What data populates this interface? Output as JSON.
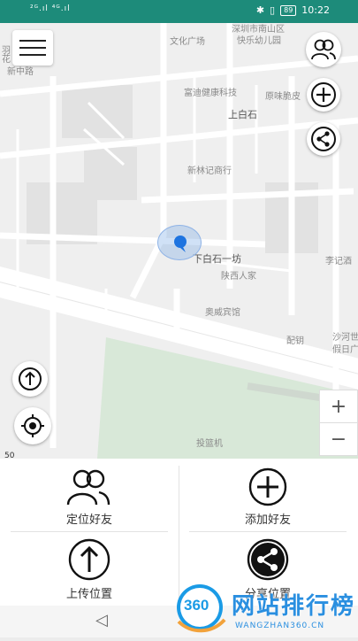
{
  "status": {
    "signal_left": "²ᴳ.ıl ⁴ᴳ.ıl",
    "battery": "89",
    "time": "10:22"
  },
  "map": {
    "labels": {
      "wenhua_square": "文化广场",
      "nanshan_district": "深圳市南山区",
      "happy_kindergarten": "快乐幼儿园",
      "fudi_health": "富迪健康科技",
      "yuanwei": "原味脆皮",
      "shangbaishi": "上白石",
      "xinlinji": "新林记商行",
      "xiabaishi": "下白石一坊",
      "shaanxi": "陕西人家",
      "liji": "李记酒",
      "aowei_hotel": "奥威宾馆",
      "peiyao": "配钥",
      "shahe": "沙河世",
      "jiari": "假日广",
      "touwa": "投篮机",
      "top_left_a": "羽",
      "top_left_b": "新中路",
      "top_left_c": "花"
    },
    "scale": "50",
    "zoom_in": "+",
    "zoom_out": "−"
  },
  "actions": {
    "locate_friends": "定位好友",
    "add_friend": "添加好友",
    "upload_location": "上传位置",
    "share_location": "分享位置"
  },
  "watermark": {
    "badge": "360",
    "title": "网站排行榜",
    "url": "WANGZHAN360.CN"
  },
  "navbar": {
    "back": "◁"
  }
}
